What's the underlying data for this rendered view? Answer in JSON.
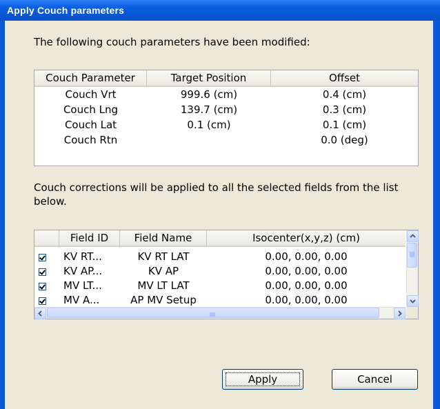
{
  "dialog": {
    "title": "Apply Couch parameters",
    "intro": "The following couch parameters have been modified:",
    "corrections_note": "Couch corrections will be applied to all the selected fields from the list below."
  },
  "couch_table": {
    "headers": [
      "Couch Parameter",
      "Target Position",
      "Offset"
    ],
    "rows": [
      [
        "Couch Vrt",
        "999.6 (cm)",
        "0.4 (cm)"
      ],
      [
        "Couch Lng",
        "139.7 (cm)",
        "0.3 (cm)"
      ],
      [
        "Couch Lat",
        "0.1 (cm)",
        "0.1 (cm)"
      ],
      [
        "Couch Rtn",
        "",
        "0.0 (deg)"
      ]
    ]
  },
  "fields_table": {
    "headers": [
      "",
      "Field ID",
      "Field Name",
      "Isocenter(x,y,z) (cm)"
    ],
    "rows": [
      {
        "checked": true,
        "id": "KV RT...",
        "name": "KV RT LAT",
        "iso": "0.00, 0.00, 0.00"
      },
      {
        "checked": true,
        "id": "KV AP...",
        "name": "KV AP",
        "iso": "0.00, 0.00, 0.00"
      },
      {
        "checked": true,
        "id": "MV LT...",
        "name": "MV LT LAT",
        "iso": "0.00, 0.00, 0.00"
      },
      {
        "checked": true,
        "id": "MV A...",
        "name": "AP MV Setup",
        "iso": "0.00, 0.00, 0.00"
      }
    ]
  },
  "buttons": {
    "apply": "Apply",
    "cancel": "Cancel"
  }
}
